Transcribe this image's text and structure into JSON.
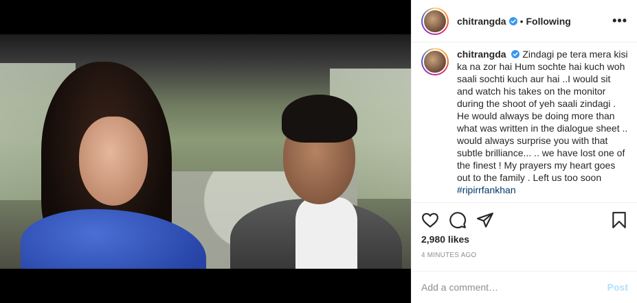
{
  "post": {
    "username": "chitrangda",
    "follow_status": "Following",
    "more_label": "•••",
    "separator": "•",
    "caption": "Zindagi pe tera mera kisi ka na zor hai Hum sochte hai kuch woh saali sochti kuch aur hai ..I would sit and watch his takes on the monitor during the shoot of yeh saali zindagi . He would always be doing more than what was written in the dialogue sheet .. would always surprise you with that subtle brilliance... .. we have lost one of the finest ! My prayers my heart goes out to the family . Left us too soon",
    "hashtag": "#ripirrfankhan",
    "likes": "2,980 likes",
    "time_ago": "4 MINUTES AGO"
  },
  "comment": {
    "placeholder": "Add a comment…",
    "post_label": "Post"
  },
  "icons": {
    "like": "heart-icon",
    "comment": "comment-icon",
    "share": "paper-plane-icon",
    "save": "bookmark-icon",
    "verified": "verified-badge-icon"
  },
  "colors": {
    "verified_blue": "#3897f0",
    "hashtag": "#00376b",
    "post_disabled": "#b2dffc",
    "muted": "#8e8e8e"
  }
}
